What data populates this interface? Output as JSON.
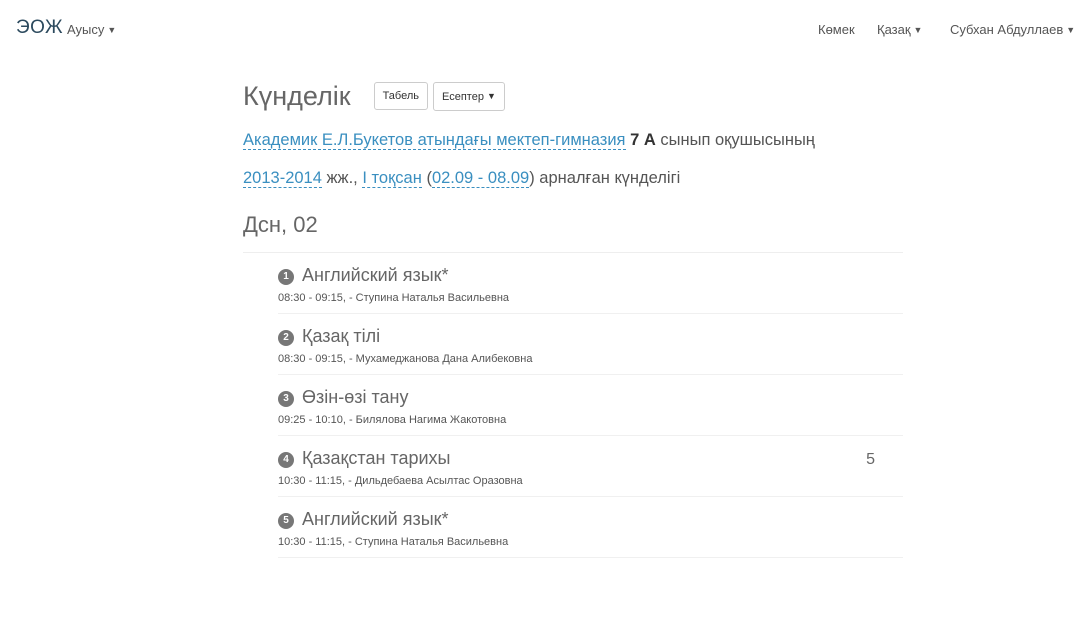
{
  "nav": {
    "brand": "ЭОЖ",
    "switch_menu": "Ауысу",
    "help": "Көмек",
    "language": "Қазақ",
    "user": "Субхан Абдуллаев"
  },
  "page": {
    "title": "Күнделік",
    "tabel_button": "Табель",
    "reports_button": "Есептер"
  },
  "description": {
    "school_link": "Академик Е.Л.Букетов атындағы мектеп-гимназия",
    "class_name": "7 А",
    "class_suffix": "сынып оқушысының",
    "year_link": "2013-2014",
    "year_suffix": "жж.,",
    "quarter_link": "I тоқсан",
    "range_open": "(",
    "range_link": "02.09 - 08.09",
    "range_close": ")",
    "tail": "арналған күнделігі"
  },
  "day": {
    "label": "Дсн, 02",
    "lessons": [
      {
        "num": "1",
        "name": "Английский язык*",
        "meta": "08:30 - 09:15, - Ступина Наталья Васильевна",
        "grade": ""
      },
      {
        "num": "2",
        "name": "Қазақ тілі",
        "meta": "08:30 - 09:15, - Мухамеджанова Дана Алибековна",
        "grade": ""
      },
      {
        "num": "3",
        "name": "Өзін-өзі тану",
        "meta": "09:25 - 10:10, - Билялова Нагима Жакотовна",
        "grade": ""
      },
      {
        "num": "4",
        "name": "Қазақстан тарихы",
        "meta": "10:30 - 11:15, - Дильдебаева Асылтас Оразовна",
        "grade": "5"
      },
      {
        "num": "5",
        "name": "Английский язык*",
        "meta": "10:30 - 11:15, - Ступина Наталья Васильевна",
        "grade": ""
      }
    ]
  }
}
